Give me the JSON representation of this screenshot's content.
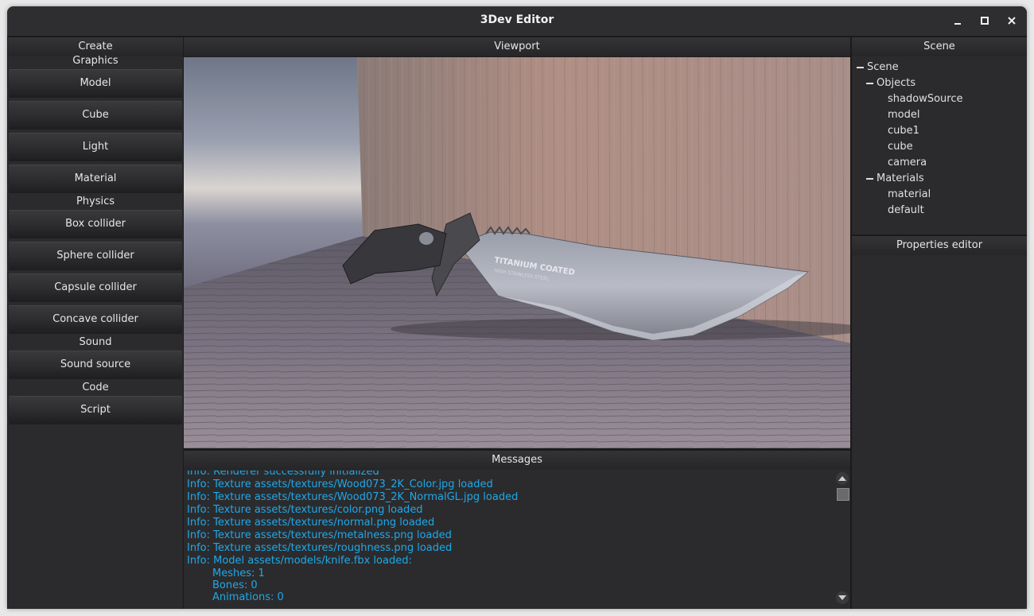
{
  "window": {
    "title": "3Dev Editor"
  },
  "create_panel": {
    "header": "Create",
    "sections": [
      {
        "label": "Graphics",
        "buttons": [
          "Model",
          "Cube",
          "Light",
          "Material"
        ]
      },
      {
        "label": "Physics",
        "buttons": [
          "Box collider",
          "Sphere collider",
          "Capsule collider",
          "Concave collider"
        ]
      },
      {
        "label": "Sound",
        "buttons": [
          "Sound source"
        ]
      },
      {
        "label": "Code",
        "buttons": [
          "Script"
        ]
      }
    ]
  },
  "viewport": {
    "header": "Viewport",
    "blade_text": "TITANIUM COATED",
    "blade_subtext": "HIGH STAINLESS STEEL"
  },
  "scene_panel": {
    "header": "Scene",
    "tree": {
      "root": "Scene",
      "objects_label": "Objects",
      "objects": [
        "shadowSource",
        "model",
        "cube1",
        "cube",
        "camera"
      ],
      "materials_label": "Materials",
      "materials": [
        "material",
        "default"
      ]
    }
  },
  "properties_panel": {
    "header": "Properties editor"
  },
  "messages_panel": {
    "header": "Messages",
    "lines": [
      "Info: Renderer successfully initialized",
      "Info: Texture assets/textures/Wood073_2K_Color.jpg loaded",
      "Info: Texture assets/textures/Wood073_2K_NormalGL.jpg loaded",
      "Info: Texture assets/textures/color.png loaded",
      "Info: Texture assets/textures/normal.png loaded",
      "Info: Texture assets/textures/metalness.png loaded",
      "Info: Texture assets/textures/roughness.png loaded",
      "Info: Model assets/models/knife.fbx loaded:"
    ],
    "sub_lines": [
      "Meshes: 1",
      "Bones: 0",
      "Animations: 0"
    ]
  },
  "colors": {
    "info_text": "#1fa8e8",
    "panel_bg": "#2b2b2d"
  },
  "icons": [
    "minimize-icon",
    "maximize-icon",
    "close-icon",
    "scroll-up-icon",
    "scroll-down-icon"
  ]
}
